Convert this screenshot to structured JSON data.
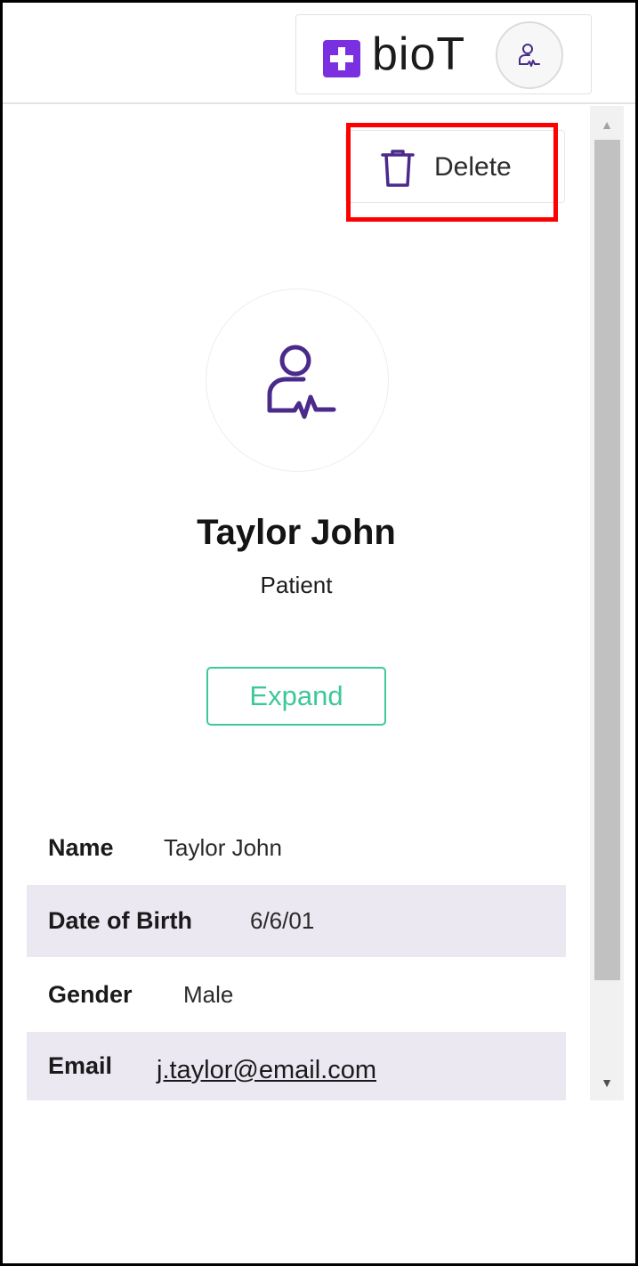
{
  "header": {
    "brand_name": "bioT",
    "brand_color": "#7a2fe0",
    "account_icon": "user-heartbeat-icon"
  },
  "toolbar": {
    "delete_label": "Delete",
    "delete_icon": "trash-icon"
  },
  "profile": {
    "avatar_icon": "patient-heartbeat-icon",
    "accent_color": "#4a2a8a",
    "name": "Taylor John",
    "role": "Patient",
    "expand_label": "Expand",
    "expand_color": "#3ec89a"
  },
  "details": [
    {
      "label": "Name",
      "value": "Taylor John"
    },
    {
      "label": "Date of Birth",
      "value": "6/6/01"
    },
    {
      "label": "Gender",
      "value": "Male"
    },
    {
      "label": "Email",
      "value": "j.taylor@email.com"
    }
  ],
  "colors": {
    "row_shade": "#ece8f2",
    "highlight": "#ff0000"
  }
}
